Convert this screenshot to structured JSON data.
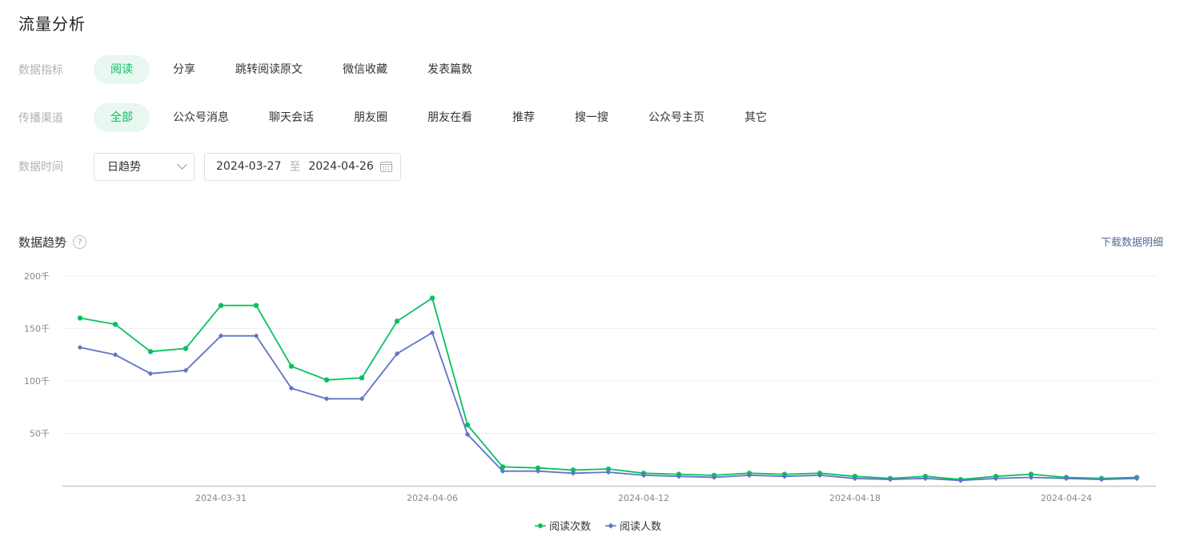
{
  "page": {
    "title": "流量分析"
  },
  "filters": {
    "metric": {
      "label": "数据指标",
      "options": [
        "阅读",
        "分享",
        "跳转阅读原文",
        "微信收藏",
        "发表篇数"
      ],
      "active": 0
    },
    "channel": {
      "label": "传播渠道",
      "options": [
        "全部",
        "公众号消息",
        "聊天会话",
        "朋友圈",
        "朋友在看",
        "推荐",
        "搜一搜",
        "公众号主页",
        "其它"
      ],
      "active": 0
    },
    "time": {
      "label": "数据时间",
      "granularity": "日趋势",
      "start_date": "2024-03-27",
      "separator": "至",
      "end_date": "2024-04-26"
    }
  },
  "trend": {
    "title": "数据趋势",
    "help": "?",
    "download_label": "下载数据明细"
  },
  "colors": {
    "accent": "#07c160",
    "series_2": "#6073c5",
    "link": "#576b95"
  },
  "chart_data": {
    "type": "line",
    "title": "",
    "xlabel": "",
    "ylabel": "",
    "ylim": [
      0,
      200000
    ],
    "yticks": [
      {
        "value": 50000,
        "label": "50千"
      },
      {
        "value": 100000,
        "label": "100千"
      },
      {
        "value": 150000,
        "label": "150千"
      },
      {
        "value": 200000,
        "label": "200千"
      }
    ],
    "x": [
      "2024-03-27",
      "2024-03-28",
      "2024-03-29",
      "2024-03-30",
      "2024-03-31",
      "2024-04-01",
      "2024-04-02",
      "2024-04-03",
      "2024-04-04",
      "2024-04-05",
      "2024-04-06",
      "2024-04-07",
      "2024-04-08",
      "2024-04-09",
      "2024-04-10",
      "2024-04-11",
      "2024-04-12",
      "2024-04-13",
      "2024-04-14",
      "2024-04-15",
      "2024-04-16",
      "2024-04-17",
      "2024-04-18",
      "2024-04-19",
      "2024-04-20",
      "2024-04-21",
      "2024-04-22",
      "2024-04-23",
      "2024-04-24",
      "2024-04-25",
      "2024-04-26"
    ],
    "xticks": [
      "2024-03-31",
      "2024-04-06",
      "2024-04-12",
      "2024-04-18",
      "2024-04-24"
    ],
    "grid": true,
    "legend_position": "bottom-center",
    "series": [
      {
        "name": "阅读次数",
        "marker": "circle",
        "color": "#07c160",
        "values": [
          160000,
          154000,
          128000,
          131000,
          172000,
          172000,
          114000,
          101000,
          103000,
          157000,
          179000,
          58000,
          18000,
          17000,
          15000,
          16000,
          12000,
          11000,
          10000,
          12000,
          11000,
          12000,
          9000,
          7000,
          9000,
          6000,
          9000,
          11000,
          8000,
          7000,
          8000
        ]
      },
      {
        "name": "阅读人数",
        "marker": "diamond",
        "color": "#6073c5",
        "values": [
          132000,
          125000,
          107000,
          110000,
          143000,
          143000,
          93000,
          83000,
          83000,
          126000,
          146000,
          49000,
          14000,
          14000,
          12000,
          13000,
          10000,
          9000,
          8000,
          10000,
          9000,
          10000,
          7000,
          6000,
          7000,
          5000,
          7000,
          8000,
          7000,
          6000,
          7000
        ]
      }
    ]
  }
}
